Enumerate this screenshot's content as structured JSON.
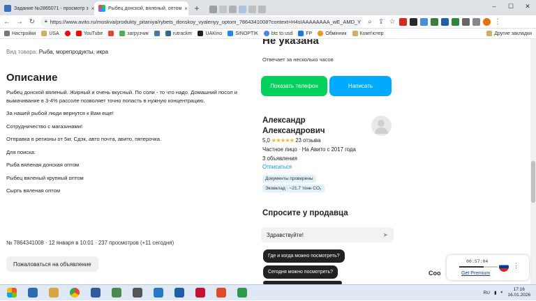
{
  "browser": {
    "tabs": [
      {
        "label": "Задание №2865071 - просмотр з",
        "icon": "sp-icon",
        "active": false
      },
      {
        "label": "Рыбец донской, вяленый, оптом",
        "icon": "avito-icon",
        "active": true
      }
    ],
    "new_tab": "+",
    "url": "https://www.avito.ru/moskva/produkty_pitaniya/rybets_donskoy_vyalenyy_optom_7864341008?context=H4sIAAAAAAAA_wE_AMD_YT..."
  },
  "bookmarks": [
    "Настройки",
    "USA",
    "YouTube",
    "загрузчик",
    "rutracker",
    "UAKino",
    "SINOPTIK",
    "btc to usd",
    "FP",
    "Обмінник",
    "Комп'ютер",
    "Другие закладки"
  ],
  "listing": {
    "goods_label": "Вид товара:",
    "goods_value": "Рыба, морепродукты, икра",
    "description_title": "Описание",
    "description": [
      "Рыбец донской вяленый. Жирный и очень вкусный. По соли - то что надо. Домашний посол и вымачивание в 3-4% рассоле позволяет точно попасть в нужную концентрацию.",
      "За нашей рыбой люди вернутся к Вам еще!",
      "Сотрудничество с магазинами!",
      "Отправка в регионы от 5кг. Сдэк, авто почта, авито, пятерочка.",
      "Для поиска:",
      "Рыба вяленая донская оптом",
      "Рыбец вяленый крупный оптом",
      "Сырть вяленая оптом"
    ],
    "meta": "№ 7864341008 · 12 января в 10:01 · 237 просмотров (+11 сегодня)",
    "complain": "Пожаловаться на объявление"
  },
  "contact": {
    "phone_heading": "Не указана",
    "reply_note": "Отвечает за несколько часов",
    "show_phone": "Показать телефон",
    "write": "Написать"
  },
  "seller": {
    "name": "Александр Александрович",
    "rating": "5,0",
    "stars": "★★★★★",
    "reviews": "23 отзыва",
    "since": "Частное лицо · На Авито с 2017 года",
    "ads": "3 объявления",
    "unsubscribe": "Отписаться",
    "badge_docs": "Документы проверены",
    "badge_eco": "Эковклад · ~21.7 тонн CO₂"
  },
  "ask": {
    "title": "Спросите у продавца",
    "input_value": "Здравствуйте!",
    "questions": [
      "Где и когда можно посмотреть?",
      "Сегодня можно посмотреть?"
    ]
  },
  "overlay": {
    "cookie_text": "Coo",
    "vpn_time": "00:57:04",
    "vpn_progress": 0.64,
    "vpn_premium": "Get Premium"
  },
  "taskbar": {
    "lang": "RU",
    "time": "17:16",
    "date": "16.01.2026"
  },
  "colors": {
    "green": "#02d15c",
    "blue": "#00aaff",
    "link": "#0099f7",
    "star": "#ffb021"
  }
}
